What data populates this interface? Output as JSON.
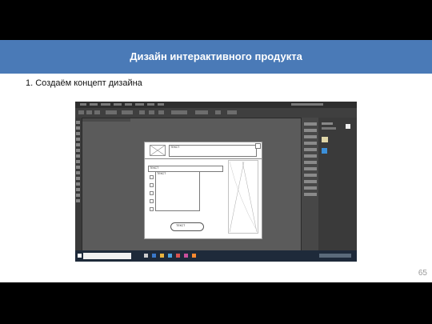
{
  "slide": {
    "title": "Дизайн интерактивного продукта",
    "subtitle": "1. Создаём концепт дизайна",
    "page_number": "65"
  },
  "screenshot": {
    "wireframe": {
      "header_label": "ТЕКСТ",
      "search_label": "ТЕКСТ",
      "list_title": "ТЕКСТ",
      "button_label": "ТЕКСТ"
    }
  },
  "colors": {
    "title_bar": "#4a7ab7",
    "app_background": "#3a3a3a",
    "canvas": "#5b5b5b"
  }
}
